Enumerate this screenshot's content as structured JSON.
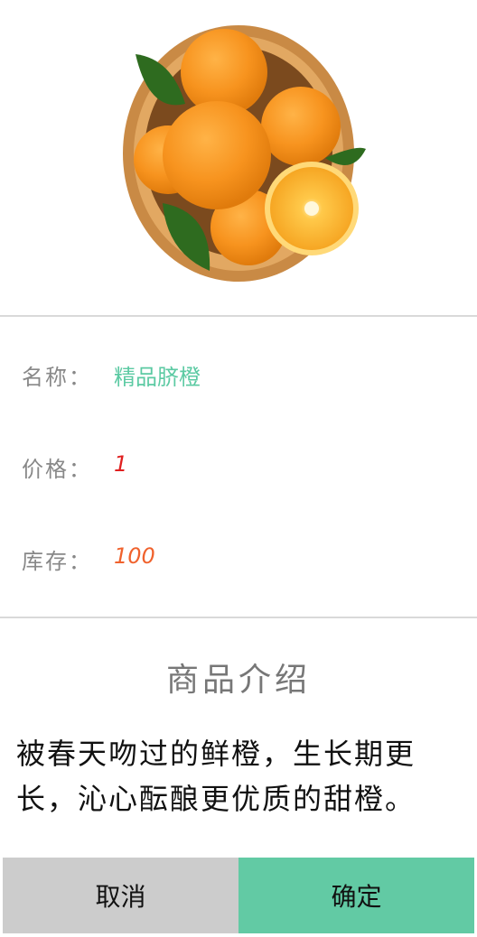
{
  "product_image": "orange-basket-image",
  "fields": {
    "name_label": "名称：",
    "name_value": "精品脐橙",
    "price_label": "价格：",
    "price_value": "1",
    "stock_label": "库存：",
    "stock_value": "100"
  },
  "intro": {
    "title": "商品介绍",
    "body": "被春天吻过的鲜橙，生长期更长，沁心酝酿更优质的甜橙。"
  },
  "actions": {
    "cancel_label": "取消",
    "confirm_label": "确定"
  },
  "colors": {
    "accent": "#62caa4",
    "name_value": "#5ccaa3",
    "price_value": "#e02020",
    "stock_value": "#f0622d",
    "cancel_bg": "#cccccc"
  }
}
